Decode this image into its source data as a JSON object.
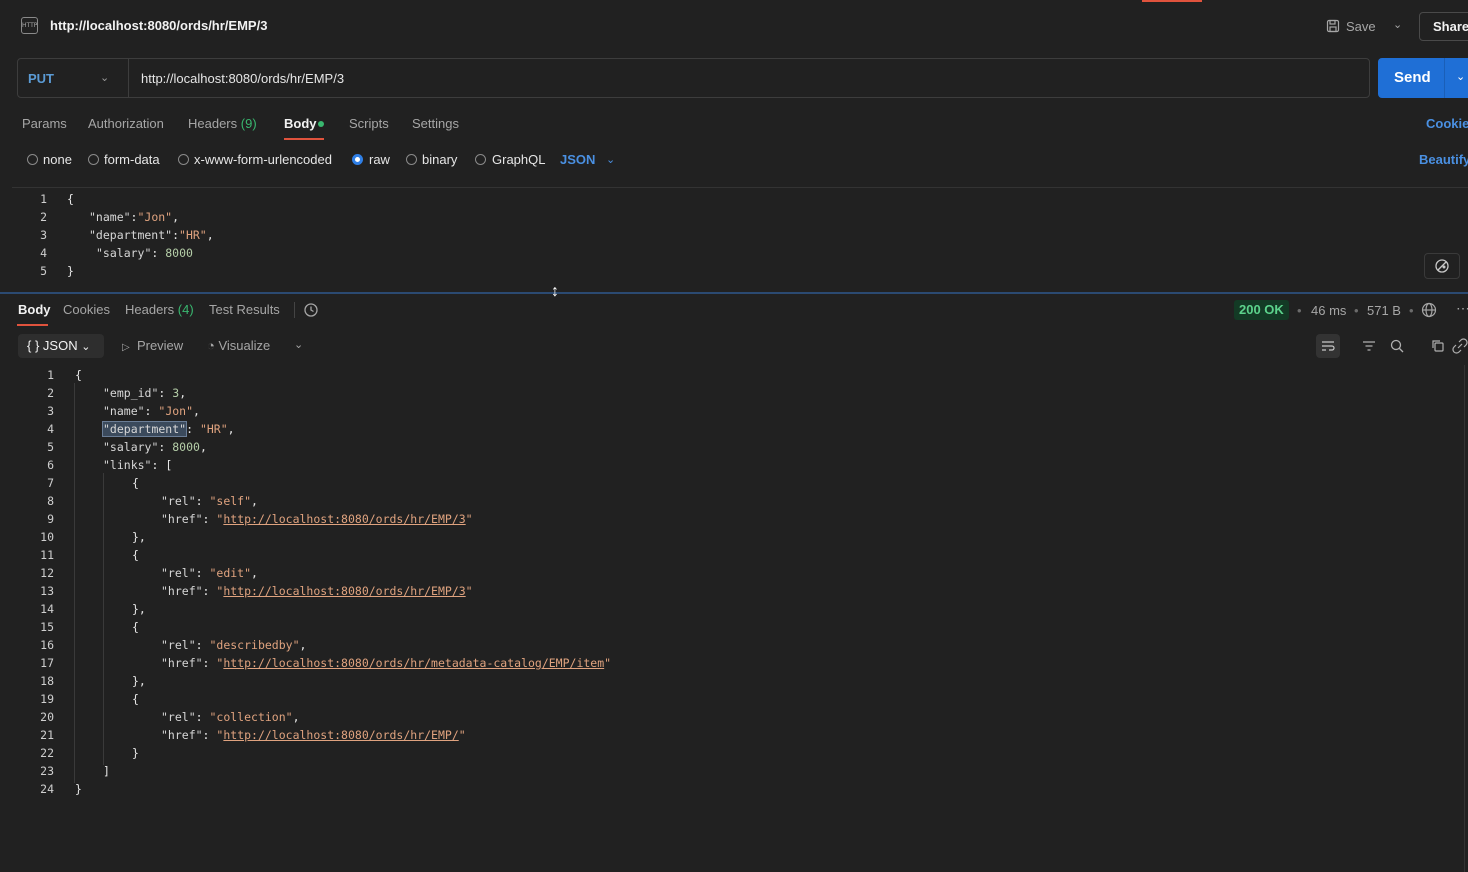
{
  "title_bar": {
    "badge": "HTTP",
    "title": "http://localhost:8080/ords/hr/EMP/3",
    "save_label": "Save",
    "share_label": "Share"
  },
  "request": {
    "method": "PUT",
    "url": "http://localhost:8080/ords/hr/EMP/3",
    "send_label": "Send",
    "tabs": [
      "Params",
      "Authorization",
      "Headers",
      "Body",
      "Scripts",
      "Settings"
    ],
    "headers_count": "(9)",
    "active_tab": "Body",
    "cookies_label": "Cookie",
    "body_types": [
      "none",
      "form-data",
      "x-www-form-urlencoded",
      "raw",
      "binary",
      "GraphQL"
    ],
    "selected_body_type": "raw",
    "body_format": "JSON",
    "beautify_label": "Beautify",
    "body_lines": [
      {
        "n": "1",
        "text": "{"
      },
      {
        "n": "2",
        "key": "\"name\"",
        "sep": ":",
        "value": "\"Jon\"",
        "tail": ","
      },
      {
        "n": "3",
        "key": "\"department\"",
        "sep": ":",
        "value": "\"HR\"",
        "tail": ","
      },
      {
        "n": "4",
        "key": "\"salary\"",
        "sep": ": ",
        "value": "8000",
        "tail": ""
      },
      {
        "n": "5",
        "text": "}"
      }
    ]
  },
  "response": {
    "tabs": [
      "Body",
      "Cookies",
      "Headers",
      "Test Results"
    ],
    "headers_count": "(4)",
    "active_tab": "Body",
    "status": "200 OK",
    "time": "46 ms",
    "size": "571 B",
    "format": "JSON",
    "preview_label": "Preview",
    "visualize_label": "Visualize",
    "lines": [
      {
        "n": "1",
        "indent": 0,
        "text": "{"
      },
      {
        "n": "2",
        "indent": 1,
        "key": "\"emp_id\"",
        "value": "3",
        "type": "num",
        "tail": ","
      },
      {
        "n": "3",
        "indent": 1,
        "key": "\"name\"",
        "value": "\"Jon\"",
        "type": "str",
        "tail": ","
      },
      {
        "n": "4",
        "indent": 1,
        "key": "\"department\"",
        "value": "\"HR\"",
        "type": "str",
        "tail": ",",
        "highlight": true
      },
      {
        "n": "5",
        "indent": 1,
        "key": "\"salary\"",
        "value": "8000",
        "type": "num",
        "tail": ","
      },
      {
        "n": "6",
        "indent": 1,
        "key": "\"links\"",
        "value": "[",
        "type": "punct",
        "tail": ""
      },
      {
        "n": "7",
        "indent": 2,
        "text": "{"
      },
      {
        "n": "8",
        "indent": 3,
        "key": "\"rel\"",
        "value": "\"self\"",
        "type": "str",
        "tail": ","
      },
      {
        "n": "9",
        "indent": 3,
        "key": "\"href\"",
        "value": "http://localhost:8080/ords/hr/EMP/3",
        "type": "link",
        "tail": ""
      },
      {
        "n": "10",
        "indent": 2,
        "text": "},"
      },
      {
        "n": "11",
        "indent": 2,
        "text": "{"
      },
      {
        "n": "12",
        "indent": 3,
        "key": "\"rel\"",
        "value": "\"edit\"",
        "type": "str",
        "tail": ","
      },
      {
        "n": "13",
        "indent": 3,
        "key": "\"href\"",
        "value": "http://localhost:8080/ords/hr/EMP/3",
        "type": "link",
        "tail": ""
      },
      {
        "n": "14",
        "indent": 2,
        "text": "},"
      },
      {
        "n": "15",
        "indent": 2,
        "text": "{"
      },
      {
        "n": "16",
        "indent": 3,
        "key": "\"rel\"",
        "value": "\"describedby\"",
        "type": "str",
        "tail": ","
      },
      {
        "n": "17",
        "indent": 3,
        "key": "\"href\"",
        "value": "http://localhost:8080/ords/hr/metadata-catalog/EMP/item",
        "type": "link",
        "tail": ""
      },
      {
        "n": "18",
        "indent": 2,
        "text": "},"
      },
      {
        "n": "19",
        "indent": 2,
        "text": "{"
      },
      {
        "n": "20",
        "indent": 3,
        "key": "\"rel\"",
        "value": "\"collection\"",
        "type": "str",
        "tail": ","
      },
      {
        "n": "21",
        "indent": 3,
        "key": "\"href\"",
        "value": "http://localhost:8080/ords/hr/EMP/",
        "type": "link",
        "tail": ""
      },
      {
        "n": "22",
        "indent": 2,
        "text": "}"
      },
      {
        "n": "23",
        "indent": 1,
        "text": "]"
      },
      {
        "n": "24",
        "indent": 0,
        "text": "}"
      }
    ]
  },
  "colors": {
    "accent_orange": "#e0533d",
    "send_blue": "#1f6fd6",
    "link_blue": "#4a90e2",
    "status_green": "#5cd38c",
    "string": "#e0a37f"
  },
  "icons": [
    "http-icon",
    "save-icon",
    "chevron-down-icon",
    "history-icon",
    "globe-icon",
    "more-icon",
    "wrap-icon",
    "filter-icon",
    "search-icon",
    "copy-icon",
    "link-icon",
    "magic-icon",
    "play-icon",
    "visualize-icon",
    "resize-cursor-icon"
  ]
}
